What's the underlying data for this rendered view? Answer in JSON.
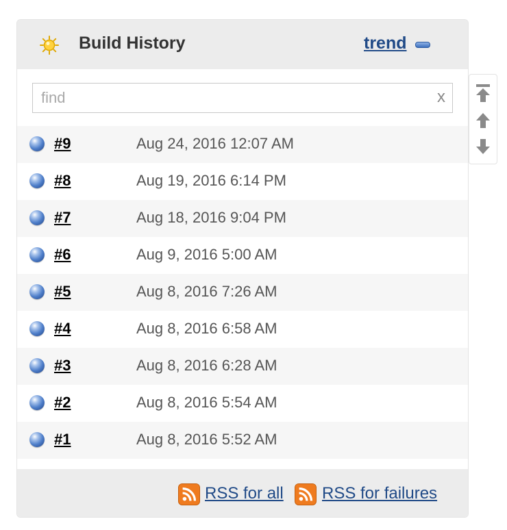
{
  "header": {
    "title": "Build History",
    "trend_label": "trend"
  },
  "search": {
    "placeholder": "find",
    "clear_label": "x"
  },
  "builds": [
    {
      "number": "#9",
      "date": "Aug 24, 2016 12:07 AM",
      "status": "success"
    },
    {
      "number": "#8",
      "date": "Aug 19, 2016 6:14 PM",
      "status": "success"
    },
    {
      "number": "#7",
      "date": "Aug 18, 2016 9:04 PM",
      "status": "success"
    },
    {
      "number": "#6",
      "date": "Aug 9, 2016 5:00 AM",
      "status": "success"
    },
    {
      "number": "#5",
      "date": "Aug 8, 2016 7:26 AM",
      "status": "success"
    },
    {
      "number": "#4",
      "date": "Aug 8, 2016 6:58 AM",
      "status": "success"
    },
    {
      "number": "#3",
      "date": "Aug 8, 2016 6:28 AM",
      "status": "success"
    },
    {
      "number": "#2",
      "date": "Aug 8, 2016 5:54 AM",
      "status": "success"
    },
    {
      "number": "#1",
      "date": "Aug 8, 2016 5:52 AM",
      "status": "success"
    }
  ],
  "footer": {
    "rss_all_label": "RSS for all",
    "rss_failures_label": "RSS for failures"
  },
  "icons": {
    "weather": "sun-icon",
    "collapse": "collapse-icon",
    "status": "blue-ball-icon",
    "rss": "rss-icon",
    "scroll_top": "scroll-top-icon",
    "scroll_up": "scroll-up-icon",
    "scroll_down": "scroll-down-icon"
  },
  "colors": {
    "link_blue": "#204a87",
    "header_bg": "#ececec",
    "row_alt_bg": "#f6f6f6",
    "status_ball": "#4f7fca",
    "rss_orange": "#e06a10"
  }
}
